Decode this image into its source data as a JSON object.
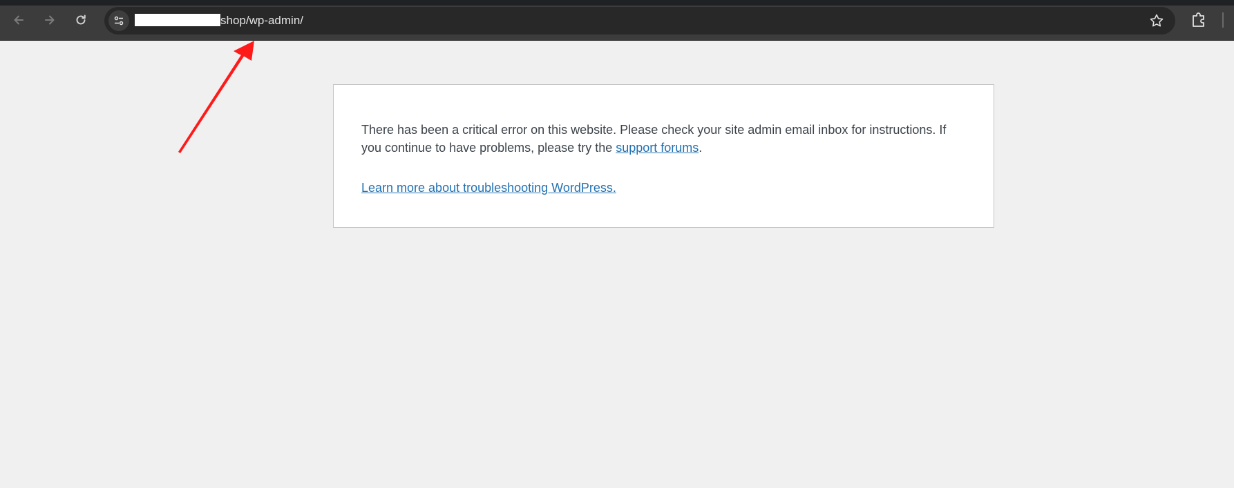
{
  "browser": {
    "url_suffix": "shop/wp-admin/",
    "icons": {
      "back": "arrow-left-icon",
      "forward": "arrow-right-icon",
      "reload": "reload-icon",
      "site_info": "tune-icon",
      "bookmark": "star-icon",
      "extensions": "puzzle-icon"
    }
  },
  "page": {
    "message_text": "There has been a critical error on this website. Please check your site admin email inbox for instructions. If you continue to have problems, please try the ",
    "support_link": "support forums",
    "message_end": ".",
    "learn_more_link": "Learn more about troubleshooting WordPress."
  },
  "annotation": {
    "arrow_color": "#ff1a1a"
  },
  "colors": {
    "page_bg": "#f0f0f1",
    "link": "#2271b1",
    "text": "#3c434a",
    "toolbar": "#3c3c3c",
    "omnibox": "#282828"
  }
}
